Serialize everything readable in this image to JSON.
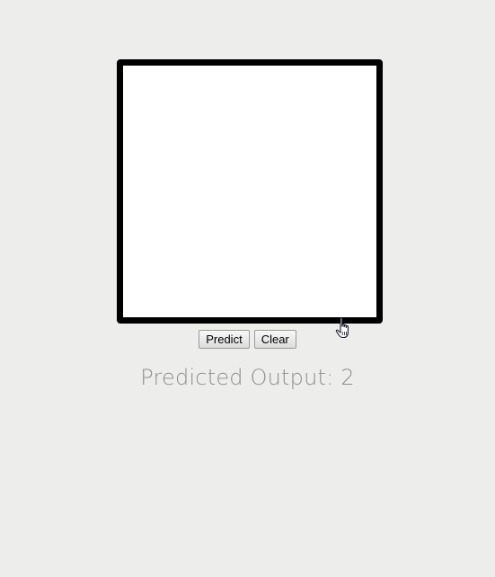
{
  "canvas": {
    "background": "#ffffff",
    "border_color": "#000000"
  },
  "controls": {
    "predict_label": "Predict",
    "clear_label": "Clear"
  },
  "output": {
    "label": "Predicted Output:",
    "value": "2"
  },
  "cursor": {
    "icon": "hand-pointer-icon"
  }
}
